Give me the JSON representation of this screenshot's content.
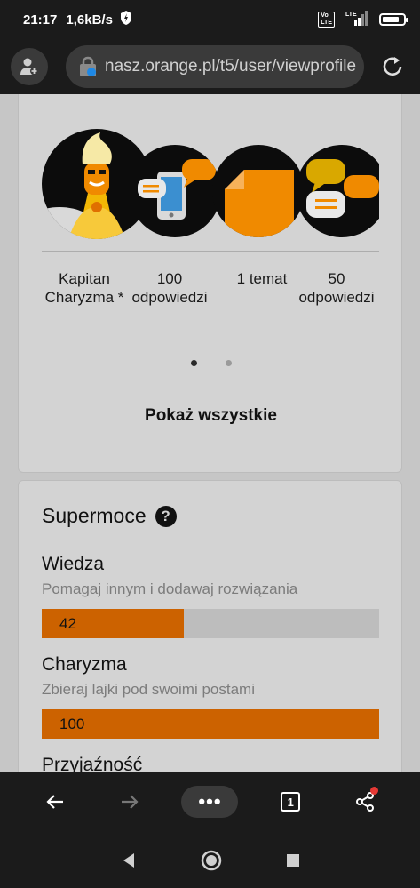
{
  "status_bar": {
    "time": "21:17",
    "net_speed": "1,6kB/s",
    "network": "LTE",
    "volte_label": "Vo\nLTE"
  },
  "browser": {
    "url": "nasz.orange.pl/t5/user/viewprofile"
  },
  "badges": {
    "items": [
      {
        "label": "Kapitan Charyzma *"
      },
      {
        "label": "100 odpowiedzi"
      },
      {
        "label": "1 temat"
      },
      {
        "label": "50 odpowiedzi"
      }
    ],
    "show_all": "Pokaż wszystkie"
  },
  "superpowers": {
    "title": "Supermoce",
    "help_icon_glyph": "?",
    "items": [
      {
        "name": "Wiedza",
        "description": "Pomagaj innym i dodawaj rozwiązania",
        "value": "42",
        "progress": 0.42
      },
      {
        "name": "Charyzma",
        "description": "Zbieraj lajki pod swoimi postami",
        "value": "100",
        "progress": 1.0
      },
      {
        "name": "Przyjaźność"
      }
    ]
  },
  "bottom_bar": {
    "menu_label": "•••",
    "tab_count": "1"
  },
  "colors": {
    "accent": "#cc6200",
    "bar_bg": "#bdbdbd",
    "dark": "#1b1b1b"
  }
}
